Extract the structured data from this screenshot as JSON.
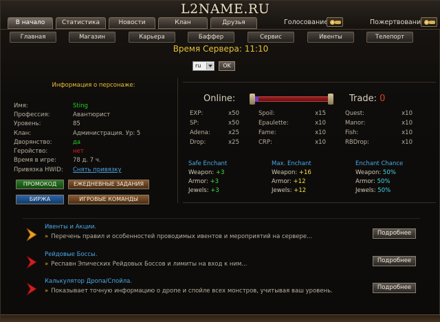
{
  "header": {
    "logo": "L2NAME.RU",
    "tabs": [
      "В начало",
      "Статистика",
      "Новости",
      "Клан",
      "Друзья"
    ],
    "active_tab": "В начало",
    "vote_label": "Голосование",
    "donate_label": "Пожертвования"
  },
  "nav": [
    "Главная",
    "Магазин",
    "Карьера",
    "Баффер",
    "Сервис",
    "Ивенты",
    "Телепорт"
  ],
  "server_time": {
    "label": "Время Сервера:",
    "value": "11:10"
  },
  "lang": {
    "selected": "ru",
    "ok_label": "OK"
  },
  "character": {
    "title": "Информация о персонаже:",
    "rows": [
      {
        "label": "Имя:",
        "value": "Sting",
        "style": "green"
      },
      {
        "label": "Профессия:",
        "value": "Авантюрист",
        "style": ""
      },
      {
        "label": "Уровень:",
        "value": "85",
        "style": ""
      },
      {
        "label": "Клан:",
        "value": "Администрация. Ур: 5",
        "style": ""
      },
      {
        "label": "Дворянство:",
        "value": "да",
        "style": "green"
      },
      {
        "label": "Геройство:",
        "value": "нет",
        "style": "red"
      },
      {
        "label": "Время в игре:",
        "value": "78 д. 7 ч.",
        "style": ""
      },
      {
        "label": "Привязка HWID:",
        "value": "Снять привязку",
        "style": "link"
      }
    ],
    "buttons": {
      "promo": "ПРОМОКОД",
      "daily": "ЕЖЕДНЕВНЫЕ ЗАДАНИЯ",
      "exchange": "БИРЖА",
      "commands": "ИГРОВЫЕ КОМАНДЫ"
    }
  },
  "server": {
    "online_label": "Online:",
    "trade_label": "Trade:",
    "trade_value": "0",
    "rates_col1": [
      {
        "name": "EXP:",
        "value": "x50"
      },
      {
        "name": "SP:",
        "value": "x50"
      },
      {
        "name": "Adena:",
        "value": "x25"
      },
      {
        "name": "Drop:",
        "value": "x25"
      }
    ],
    "rates_col2": [
      {
        "name": "Spoil:",
        "value": "x15"
      },
      {
        "name": "Epaulette:",
        "value": "x10"
      },
      {
        "name": "Fame:",
        "value": "x10"
      },
      {
        "name": "CRP:",
        "value": "x10"
      }
    ],
    "rates_col3": [
      {
        "name": "Quest:",
        "value": "x10"
      },
      {
        "name": "Manor:",
        "value": "x10"
      },
      {
        "name": "Fish:",
        "value": "x10"
      },
      {
        "name": "RBDrop:",
        "value": "x10"
      }
    ],
    "enchant": [
      {
        "title": "Safe Enchant",
        "rows": [
          {
            "label": "Weapon:",
            "value": "+3"
          },
          {
            "label": "Armor:",
            "value": "+3"
          },
          {
            "label": "Jewels:",
            "value": "+3"
          }
        ]
      },
      {
        "title": "Max. Enchant",
        "rows": [
          {
            "label": "Weapon:",
            "value": "+16"
          },
          {
            "label": "Armor:",
            "value": "+12"
          },
          {
            "label": "Jewels:",
            "value": "+12"
          }
        ]
      },
      {
        "title": "Enchant Chance",
        "rows": [
          {
            "label": "Weapon:",
            "value": "50%"
          },
          {
            "label": "Armor:",
            "value": "50%"
          },
          {
            "label": "Jewels:",
            "value": "50%"
          }
        ]
      }
    ]
  },
  "news": [
    {
      "title": "Ивенты и Акции.",
      "bullet": "»",
      "desc": "Перечень правил и особенностей проводимых ивентов и мероприятий на сервере...",
      "button": "Подробнее",
      "arrow": "orange"
    },
    {
      "title": "Рейдовые Боссы.",
      "bullet": "»",
      "desc": "Респавн Эпических Рейдовых Боссов и лимиты на вход к ним...",
      "button": "Подробнее",
      "arrow": "red"
    },
    {
      "title": "Калькулятор Дропа/Спойла.",
      "bullet": "»",
      "desc": "Показывает точную информацию о дропе и спойле всех монстров, учитывая ваш уровень.",
      "button": "Подробнее",
      "arrow": "red"
    }
  ]
}
